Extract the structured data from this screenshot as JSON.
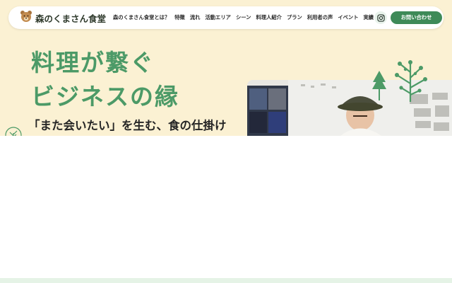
{
  "brand": {
    "title": "森のくまさん食堂",
    "logo_icon": "bear-icon"
  },
  "nav": {
    "items": [
      "森のくまさん食堂とは？",
      "特徴",
      "流れ",
      "活動エリア",
      "シーン",
      "料理人紹介",
      "プラン",
      "利用者の声",
      "イベント",
      "実績"
    ]
  },
  "header": {
    "instagram_icon": "instagram-icon",
    "contact_label": "お問い合わせ"
  },
  "hero": {
    "headline_line1": "料理が繋ぐ",
    "headline_line2": "ビジネスの縁",
    "subheadline": "「また会いたい」を生む、食の仕掛け"
  },
  "colors": {
    "hero_bg": "#fbf1d3",
    "accent_green": "#4c9a67",
    "button_green": "#3e8a58",
    "footer_band": "#e5f3e6"
  }
}
